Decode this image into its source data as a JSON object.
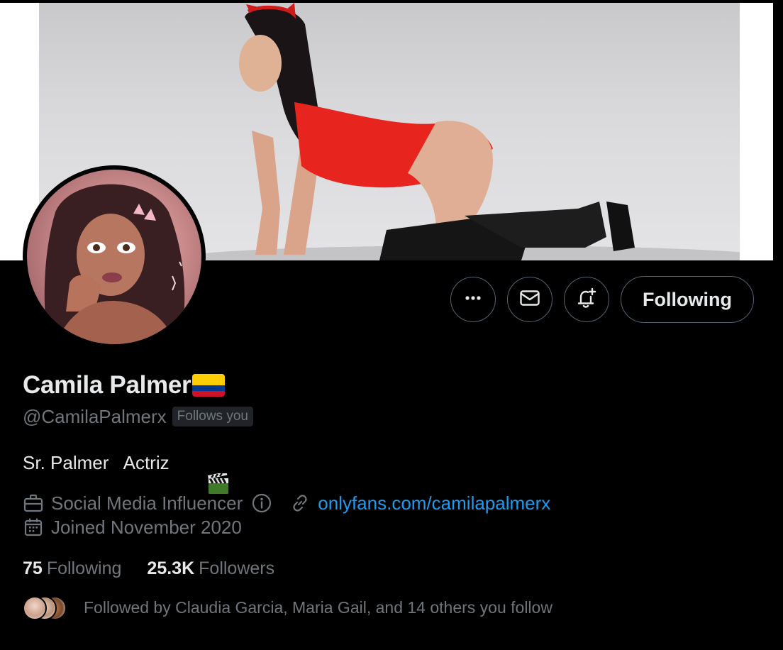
{
  "profile": {
    "display_name": "Camila Palmer",
    "name_flag": "colombia-flag",
    "handle": "@CamilaPalmerx",
    "follows_you_badge": "Follows you",
    "bio_part1": "Sr. Palmer   Actriz",
    "bio_emoji": "clapper-board",
    "category": "Social Media Influencer",
    "website": "onlyfans.com/camilapalmerx",
    "joined": "Joined November 2020"
  },
  "actions": {
    "more_icon": "more-horizontal-icon",
    "message_icon": "envelope-icon",
    "notify_icon": "bell-plus-icon",
    "following_label": "Following"
  },
  "stats": {
    "following_count": "75",
    "following_label": "Following",
    "followers_count": "25.3K",
    "followers_label": "Followers"
  },
  "followed_by": {
    "text": "Followed by Claudia Garcia, Maria Gail, and 14 others you follow"
  },
  "colors": {
    "background": "#000000",
    "text_primary": "#e7e9ea",
    "text_secondary": "#71767b",
    "link": "#1d9bf0",
    "border": "#536471"
  }
}
